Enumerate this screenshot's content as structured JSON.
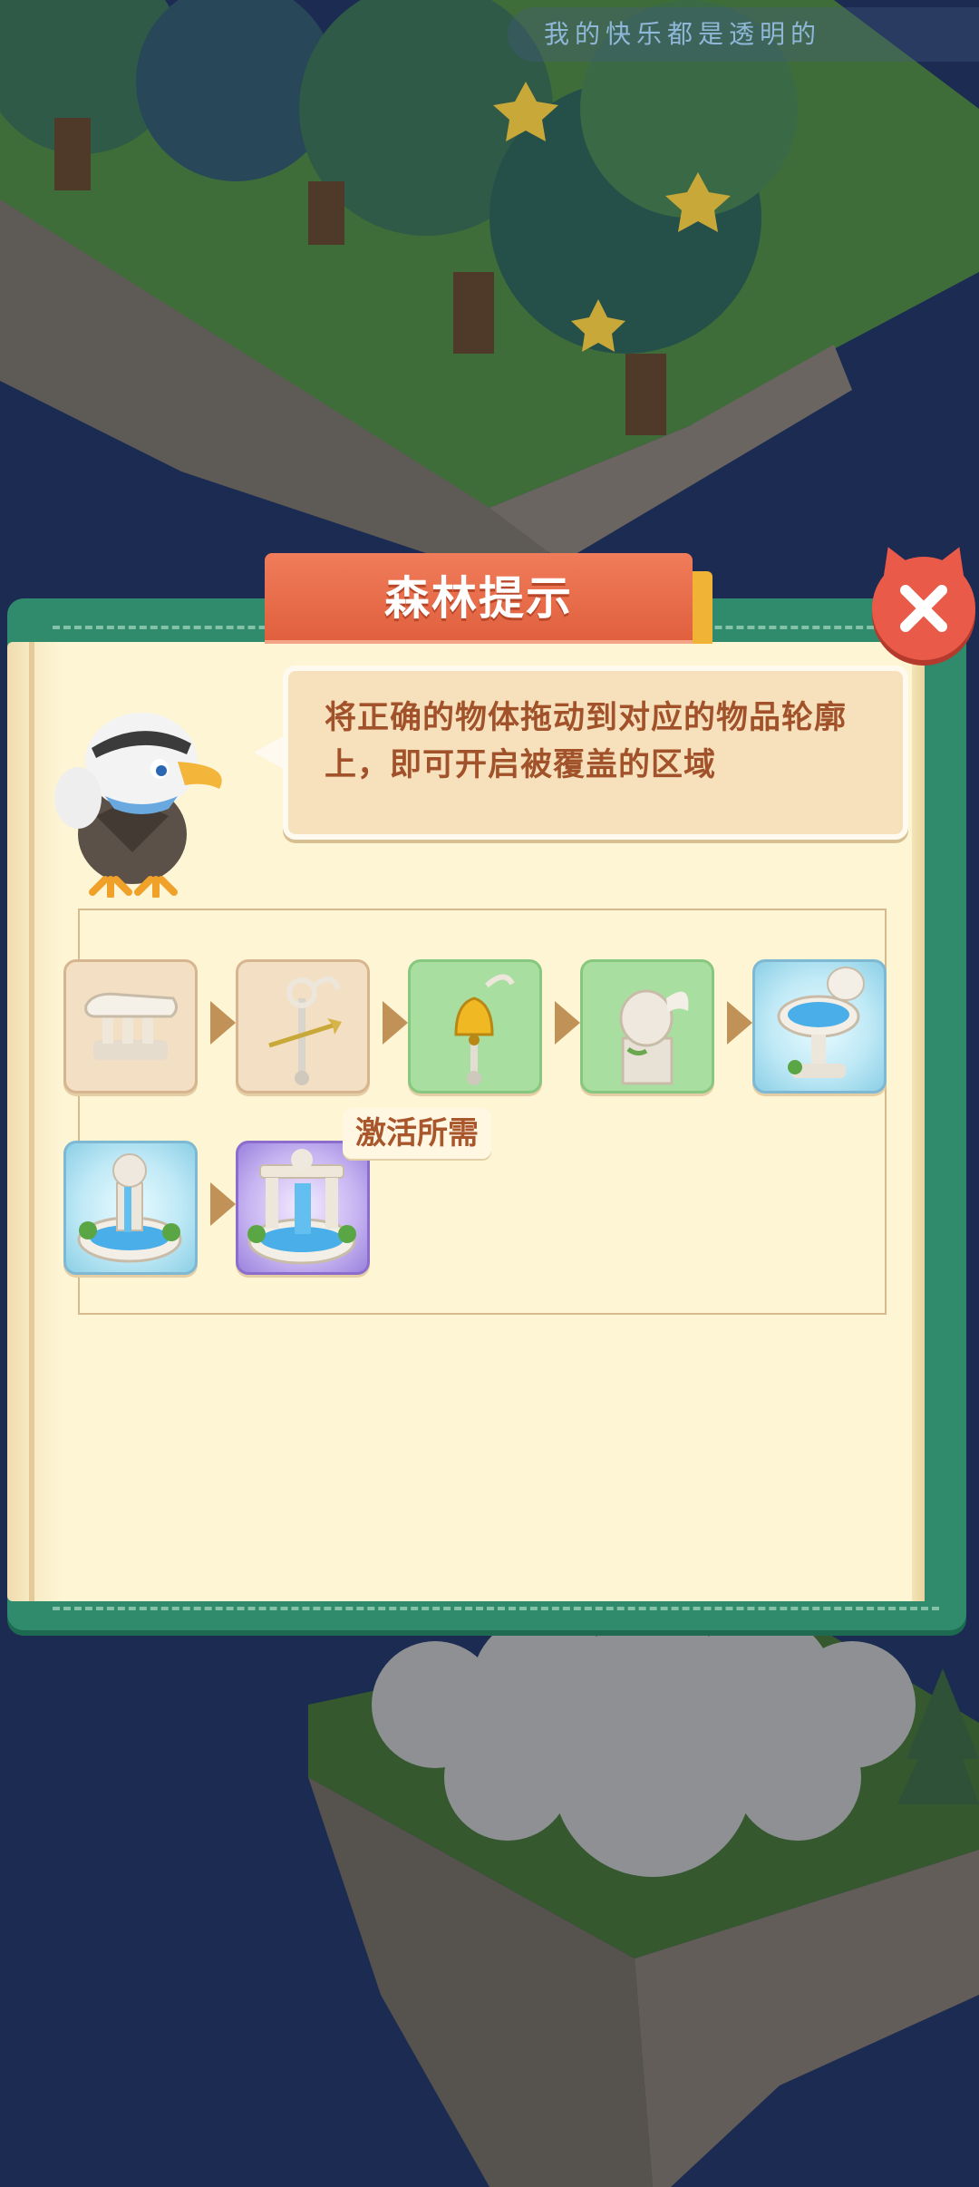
{
  "marquee_text": "我的快乐都是透明的",
  "dialog": {
    "title": "森林提示",
    "hint": "将正确的物体拖动到对应的物品轮廓上，即可开启被覆盖的区域",
    "requirement_label": "激活所需",
    "close_icon": "close-icon"
  },
  "items": [
    {
      "name": "broken-pillar",
      "style": "plain"
    },
    {
      "name": "ornate-staff",
      "style": "plain"
    },
    {
      "name": "golden-bell-staff",
      "style": "green"
    },
    {
      "name": "winged-statue",
      "style": "green"
    },
    {
      "name": "small-fountain",
      "style": "blue"
    },
    {
      "name": "statue-fountain",
      "style": "blue"
    },
    {
      "name": "waterfall-fountain",
      "style": "purple"
    }
  ],
  "colors": {
    "title_banner": "#e05f3d",
    "panel_green": "#2f8b6c",
    "hint_text": "#a2522a",
    "close_button": "#ea5a48"
  }
}
